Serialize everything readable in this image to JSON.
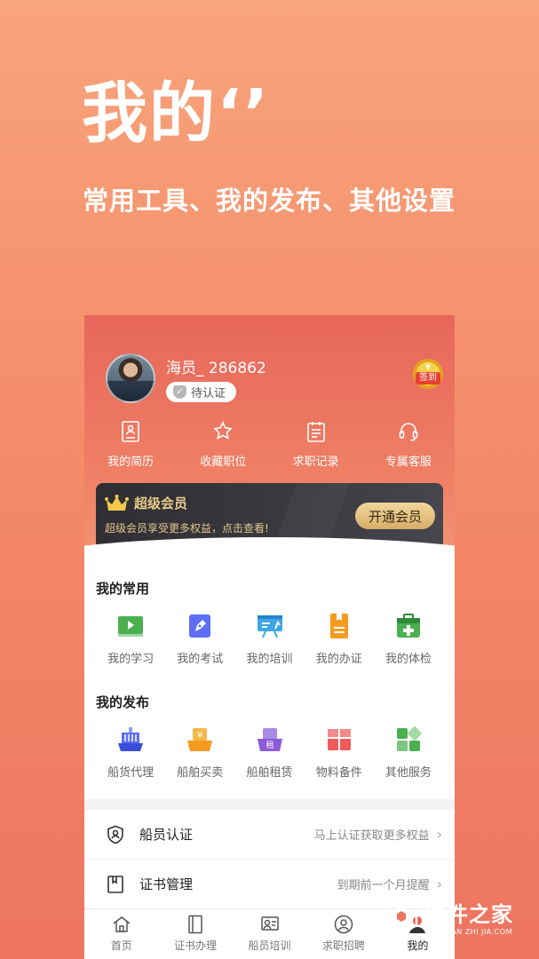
{
  "promo": {
    "title": "我的‘’",
    "subtitle": "常用工具、我的发布、其他设置"
  },
  "profile": {
    "username": "海员_ 286862",
    "auth_status": "待认证",
    "checkin_symbol": "¥",
    "checkin_label": "签到"
  },
  "quick_links": [
    {
      "label": "我的简历",
      "icon": "resume-icon"
    },
    {
      "label": "收藏职位",
      "icon": "star-icon"
    },
    {
      "label": "求职记录",
      "icon": "clipboard-icon"
    },
    {
      "label": "专属客服",
      "icon": "headset-icon"
    }
  ],
  "vip": {
    "title": "超级会员",
    "desc": "超级会员享受更多权益，点击查看!",
    "button": "开通会员"
  },
  "common": {
    "title": "我的常用",
    "items": [
      {
        "label": "我的学习",
        "icon": "video-icon",
        "color": "#4caf50"
      },
      {
        "label": "我的考试",
        "icon": "pen-icon",
        "color": "#5b6ef5"
      },
      {
        "label": "我的培训",
        "icon": "board-icon",
        "color": "#3fa7e8"
      },
      {
        "label": "我的办证",
        "icon": "certificate-icon",
        "color": "#f39a1f"
      },
      {
        "label": "我的体检",
        "icon": "medical-kit-icon",
        "color": "#4caf50"
      }
    ]
  },
  "publish": {
    "title": "我的发布",
    "items": [
      {
        "label": "船货代理",
        "icon": "cargo-ship-icon",
        "color": "#5b6ef5"
      },
      {
        "label": "船舶买卖",
        "icon": "ship-sale-icon",
        "color": "#f39a1f"
      },
      {
        "label": "船舶租赁",
        "icon": "ship-rent-icon",
        "color": "#8d5bd8"
      },
      {
        "label": "物料备件",
        "icon": "parts-box-icon",
        "color": "#ef5a5a"
      },
      {
        "label": "其他服务",
        "icon": "grid-services-icon",
        "color": "#4caf50"
      }
    ]
  },
  "list": [
    {
      "label": "船员认证",
      "hint": "马上认证获取更多权益",
      "icon": "shield-user-icon"
    },
    {
      "label": "证书管理",
      "hint": "到期前一个月提醒",
      "icon": "book-icon"
    }
  ],
  "tabs": [
    {
      "label": "首页",
      "icon": "home-icon",
      "active": false
    },
    {
      "label": "证书办理",
      "icon": "certificate-book-icon",
      "active": false
    },
    {
      "label": "船员培训",
      "icon": "training-icon",
      "active": false
    },
    {
      "label": "求职招聘",
      "icon": "user-circle-icon",
      "active": false
    },
    {
      "label": "我的",
      "icon": "profile-icon",
      "active": true
    }
  ],
  "watermark": {
    "cn": "硬件之家",
    "en": "YING JIAN ZHI JIA.COM"
  },
  "colors": {
    "accent": "#ee7560",
    "vip_gold": "#e8c98a",
    "vip_dark": "#2e2e33"
  }
}
